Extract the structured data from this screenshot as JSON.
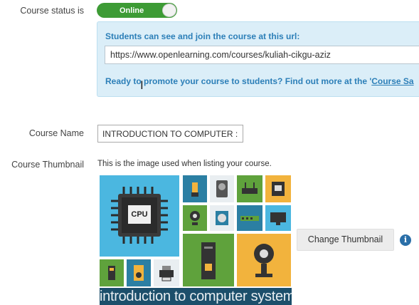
{
  "status": {
    "label": "Course status is",
    "toggle_text": "Online"
  },
  "share": {
    "heading": "Students can see and join the course at this url:",
    "url": "https://www.openlearning.com/courses/kuliah-cikgu-aziz",
    "promo_text": "Ready to promote your course to students? Find out more at the '",
    "promo_link": "Course Sa"
  },
  "course_name": {
    "label": "Course Name",
    "value": "INTRODUCTION TO COMPUTER :"
  },
  "thumbnail": {
    "label": "Course Thumbnail",
    "hint": "This is the image used when listing your course.",
    "cpu_text": "CPU",
    "caption": "introduction to computer system",
    "change_button": "Change Thumbnail"
  },
  "icons": {
    "info": "info-icon",
    "cursor": "text-cursor-icon"
  },
  "colors": {
    "toggle_on": "#3d9b35",
    "info_box_bg": "#dbeef8",
    "link_blue": "#2c7fb8",
    "info_icon": "#2a6fa8"
  }
}
